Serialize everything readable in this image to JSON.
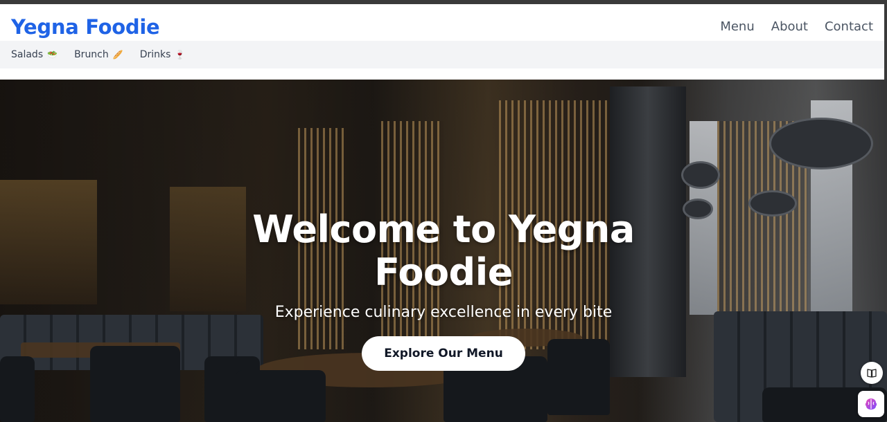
{
  "header": {
    "brand": "Yegna Foodie",
    "nav": [
      {
        "label": "Menu"
      },
      {
        "label": "About"
      },
      {
        "label": "Contact"
      }
    ]
  },
  "subnav": {
    "items": [
      {
        "label": "Salads",
        "emoji": "🥗"
      },
      {
        "label": "Brunch",
        "emoji": "🥖"
      },
      {
        "label": "Drinks",
        "emoji": "🍷"
      }
    ]
  },
  "hero": {
    "title": "Welcome to Yegna Foodie",
    "subtitle": "Experience culinary excellence in every bite",
    "cta_label": "Explore Our Menu"
  },
  "floating": {
    "book_icon": "book-icon",
    "ai_icon": "brain-icon"
  },
  "colors": {
    "brand": "#1f63e6",
    "nav_text": "#4b5563",
    "subnav_bg": "#f3f4f6"
  }
}
